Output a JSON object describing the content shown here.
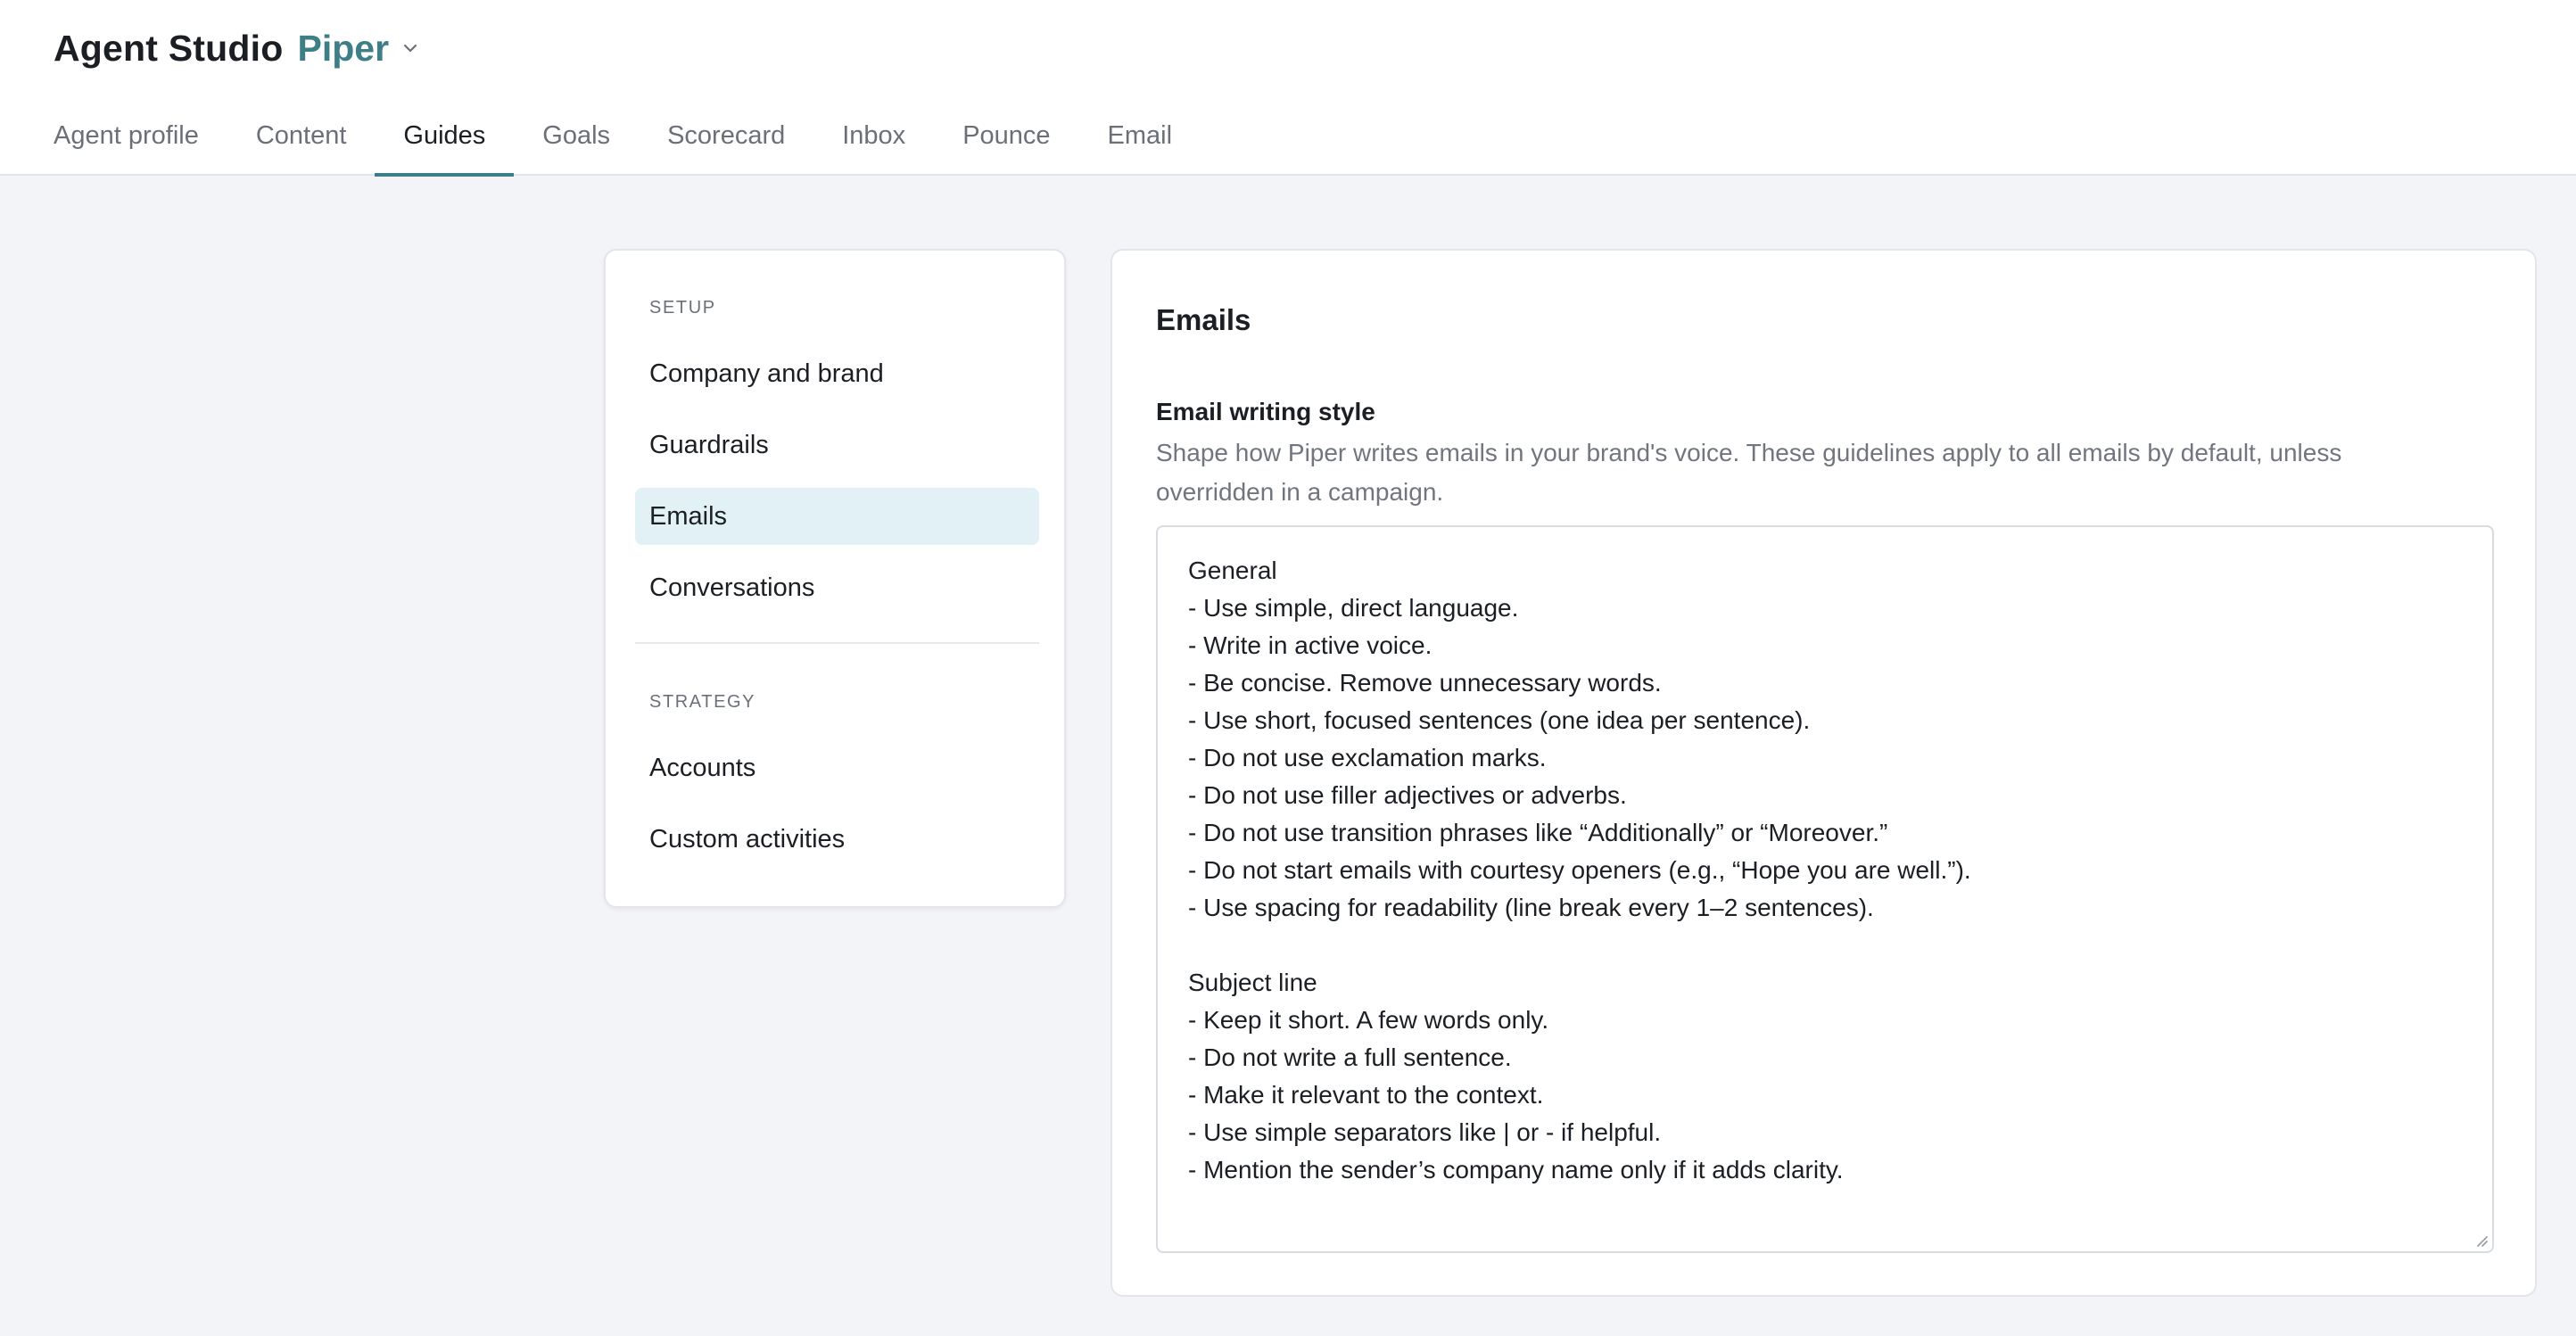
{
  "header": {
    "app_title": "Agent Studio",
    "agent_name": "Piper",
    "agent_menu_icon": "chevron-down-icon",
    "tabs": [
      {
        "label": "Agent profile",
        "active": false
      },
      {
        "label": "Content",
        "active": false
      },
      {
        "label": "Guides",
        "active": true
      },
      {
        "label": "Goals",
        "active": false
      },
      {
        "label": "Scorecard",
        "active": false
      },
      {
        "label": "Inbox",
        "active": false
      },
      {
        "label": "Pounce",
        "active": false
      },
      {
        "label": "Email",
        "active": false
      }
    ],
    "accent_color": "#3d7e87"
  },
  "sidebar": {
    "sections": [
      {
        "label": "SETUP",
        "items": [
          {
            "label": "Company and brand",
            "active": false
          },
          {
            "label": "Guardrails",
            "active": false
          },
          {
            "label": "Emails",
            "active": true
          },
          {
            "label": "Conversations",
            "active": false
          }
        ]
      },
      {
        "label": "STRATEGY",
        "items": [
          {
            "label": "Accounts",
            "active": false
          },
          {
            "label": "Custom activities",
            "active": false
          }
        ]
      }
    ],
    "active_bg_color": "#e1f1f5"
  },
  "main": {
    "title": "Emails",
    "field": {
      "label": "Email writing style",
      "help": "Shape how Piper writes emails in your brand's voice. These guidelines apply to all emails by default, unless overridden in a campaign.",
      "value": "General\n- Use simple, direct language.\n- Write in active voice.\n- Be concise. Remove unnecessary words.\n- Use short, focused sentences (one idea per sentence).\n- Do not use exclamation marks.\n- Do not use filler adjectives or adverbs.\n- Do not use transition phrases like “Additionally” or “Moreover.”\n- Do not start emails with courtesy openers (e.g., “Hope you are well.”).\n- Use spacing for readability (line break every 1–2 sentences).\n\nSubject line\n- Keep it short. A few words only.\n- Do not write a full sentence.\n- Make it relevant to the context.\n- Use simple separators like | or - if helpful.\n- Mention the sender’s company name only if it adds clarity.",
      "resize_icon": "resize-handle-icon"
    }
  }
}
